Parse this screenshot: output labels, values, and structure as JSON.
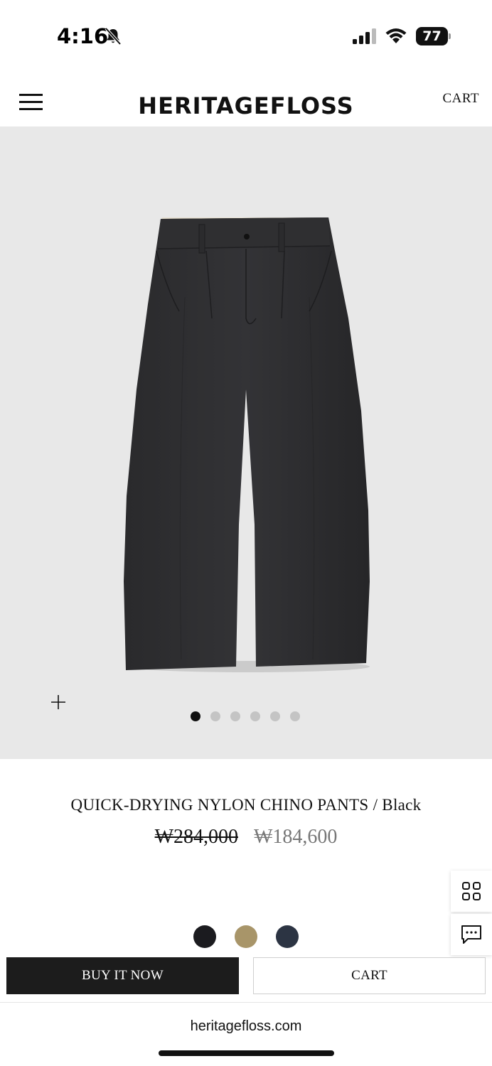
{
  "status_bar": {
    "time": "4:16",
    "battery": "77",
    "icons": [
      "bell-slash-icon",
      "signal-icon",
      "wifi-icon",
      "battery-icon"
    ]
  },
  "header": {
    "brand": "HERITAGEFLOSS",
    "cart_label": "CART"
  },
  "gallery": {
    "total_images": 6,
    "active_index": 0,
    "background": "#e8e8e8"
  },
  "product": {
    "name": "QUICK-DRYING NYLON CHINO PANTS / Black",
    "original_price": "₩284,000",
    "sale_price": "₩184,600"
  },
  "colors": {
    "swatches": [
      "#1b1b1f",
      "#a89569",
      "#2c3443"
    ]
  },
  "actions": {
    "buy_now_label": "BUY IT NOW",
    "cart_label": "CART"
  },
  "browser": {
    "url": "heritagefloss.com"
  }
}
